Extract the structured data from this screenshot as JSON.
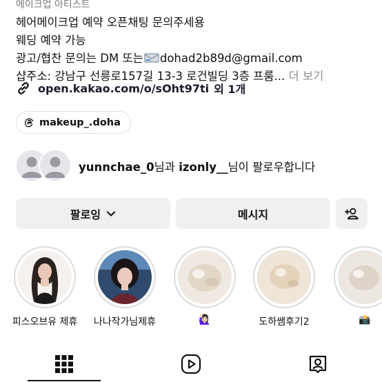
{
  "bio": {
    "line0": "메이크업 아티스트",
    "line1": "헤어메이크업 예약 오픈채팅 문의주세용",
    "line2": "웨딩 예약 가능",
    "line3_prefix": "광고/협찬 문의는 DM 또는",
    "line3_email": "dohad2b89d@gmail.com",
    "line4_address": "샵주소: 강남구 선릉로157길 13-3 로건빌딩 3층 프룸...",
    "more_label": "더 보기"
  },
  "link": {
    "url": "open.kakao.com/o/sOht97ti",
    "extra": "외 1개"
  },
  "threads": {
    "handle": "makeup_.doha"
  },
  "followed_by": {
    "user1": "yunnchae_0",
    "connector1": "님과",
    "user2": "izonly__",
    "connector2": "님이 팔로우합니다"
  },
  "buttons": {
    "follow_label": "팔로잉",
    "message_label": "메시지"
  },
  "highlights": [
    {
      "label": "피스오브유 제휴"
    },
    {
      "label": "나나작가님제휴"
    },
    {
      "label": "🙋🏻‍♀️"
    },
    {
      "label": "도하쌤후기2"
    },
    {
      "label": "📸"
    }
  ],
  "icons": {
    "link": "link-icon",
    "threads": "threads-icon",
    "chevron": "chevron-down-icon",
    "add_user": "add-user-icon",
    "grid": "grid-icon",
    "reels": "reels-icon",
    "tagged": "tagged-icon"
  },
  "colors": {
    "button_bg": "#eff0f2",
    "muted_text": "#8e8e8e",
    "text": "#111111"
  }
}
